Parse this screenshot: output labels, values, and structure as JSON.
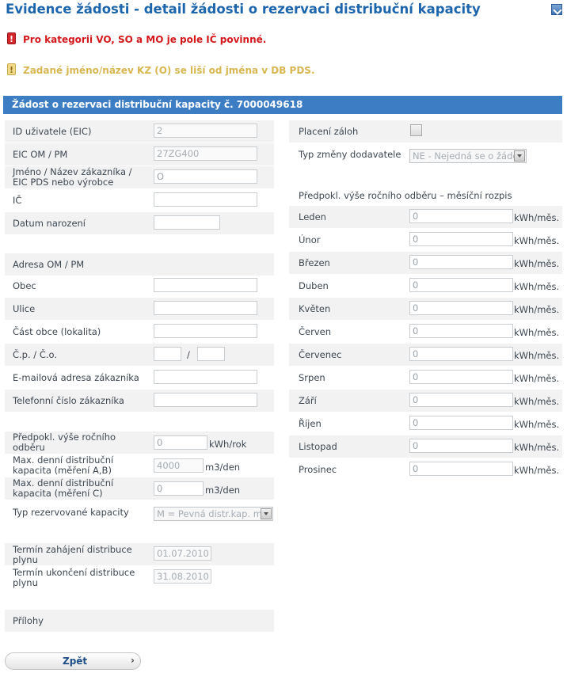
{
  "page": {
    "title": "Evidence žádosti - detail žádosti o rezervaci distribuční kapacity"
  },
  "messages": {
    "error": "Pro kategorii VO, SO a MO je pole IČ povinné.",
    "error_icon": "!",
    "warning": "Zadané jméno/název KZ (O) se liší od jména v DB PDS.",
    "warning_icon": "!"
  },
  "form": {
    "header": "Žádost o rezervaci distribuční kapacity č. 7000049618",
    "id_user_label": "ID uživatele (EIC)",
    "id_user_value": "2",
    "eic_om_label": "EIC OM / PM",
    "eic_om_value": "27ZG400",
    "name_label": "Jméno / Název zákazníka / EIC PDS nebo výrobce",
    "name_value": "O",
    "ic_label": "IČ",
    "ic_value": "",
    "birth_label": "Datum narození",
    "birth_value": "",
    "address_section": "Adresa OM / PM",
    "obec_label": "Obec",
    "obec_value": "",
    "ulice_label": "Ulice",
    "ulice_value": "",
    "cast_obce_label": "Část obce (lokalita)",
    "cast_obce_value": "",
    "cp_label": "Č.p. / Č.o.",
    "cp_value": "",
    "co_separator": "/",
    "co_value": "",
    "email_label": "E-mailová adresa zákazníka",
    "email_value": "",
    "phone_label": "Telefonní číslo zákazníka",
    "phone_value": "",
    "annual_label": "Předpokl. výše ročního odběru",
    "annual_value": "0",
    "annual_unit": "kWh/rok",
    "max_ab_label": "Max. denní distribuční kapacita (měření A,B)",
    "max_ab_value": "4000",
    "max_ab_unit": "m3/den",
    "max_c_label": "Max. denní distribuční kapacita (měření C)",
    "max_c_value": "0",
    "max_c_unit": "m3/den",
    "capacity_type_label": "Typ rezervované kapacity",
    "capacity_type_value": "M = Pevná distr.kap. mě",
    "start_label": "Termín zahájení distribuce plynu",
    "start_value": "01.07.2010",
    "end_label": "Termín ukončení distribuce plynu",
    "end_value": "31.08.2010",
    "attachments_label": "Přílohy"
  },
  "right": {
    "deposit_label": "Placení záloh",
    "supplier_change_label": "Typ změny dodavatele",
    "supplier_change_value": "NE - Nejedná se o žádo",
    "monthly_header": "Předpokl. výše ročního odběru – měsíční rozpis",
    "unit": "kWh/měs.",
    "months": [
      {
        "name": "Leden",
        "value": "0"
      },
      {
        "name": "Únor",
        "value": "0"
      },
      {
        "name": "Březen",
        "value": "0"
      },
      {
        "name": "Duben",
        "value": "0"
      },
      {
        "name": "Květen",
        "value": "0"
      },
      {
        "name": "Červen",
        "value": "0"
      },
      {
        "name": "Červenec",
        "value": "0"
      },
      {
        "name": "Srpen",
        "value": "0"
      },
      {
        "name": "Září",
        "value": "0"
      },
      {
        "name": "Říjen",
        "value": "0"
      },
      {
        "name": "Listopad",
        "value": "0"
      },
      {
        "name": "Prosinec",
        "value": "0"
      }
    ]
  },
  "buttons": {
    "back": "Zpět",
    "back_arrow": "›"
  },
  "icons": {
    "help": "help-arrow-icon",
    "error": "error-icon",
    "warning": "warning-icon"
  },
  "colors": {
    "title": "#1d66ad",
    "header_bar": "#3c7dc3",
    "error_text": "#d4181c",
    "warning_text": "#d8b751",
    "row_background": "#f2f2f2"
  }
}
